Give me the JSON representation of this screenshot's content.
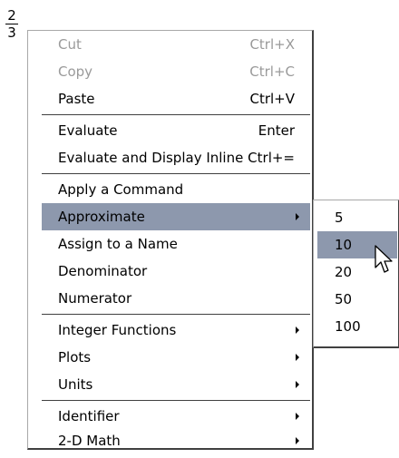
{
  "fraction": {
    "numerator": "2",
    "denominator": "3"
  },
  "context_menu": {
    "items": [
      {
        "label": "Cut",
        "shortcut": "Ctrl+X",
        "enabled": false
      },
      {
        "label": "Copy",
        "shortcut": "Ctrl+C",
        "enabled": false
      },
      {
        "label": "Paste",
        "shortcut": "Ctrl+V",
        "enabled": true
      },
      {
        "label": "Evaluate",
        "shortcut": "Enter",
        "enabled": true
      },
      {
        "label": "Evaluate and Display Inline",
        "shortcut": "Ctrl+=",
        "enabled": true
      },
      {
        "label": "Apply a Command",
        "enabled": true
      },
      {
        "label": "Approximate",
        "has_submenu": true,
        "highlighted": true
      },
      {
        "label": "Assign to a Name",
        "enabled": true
      },
      {
        "label": "Denominator",
        "enabled": true
      },
      {
        "label": "Numerator",
        "enabled": true
      },
      {
        "label": "Integer Functions",
        "has_submenu": true
      },
      {
        "label": "Plots",
        "has_submenu": true
      },
      {
        "label": "Units",
        "has_submenu": true
      },
      {
        "label": "Identifier",
        "has_submenu": true
      },
      {
        "label": "2-D Math",
        "has_submenu": true
      }
    ]
  },
  "approximate_submenu": {
    "items": [
      {
        "label": "5"
      },
      {
        "label": "10",
        "highlighted": true
      },
      {
        "label": "20"
      },
      {
        "label": "50"
      },
      {
        "label": "100"
      }
    ]
  },
  "colors": {
    "highlight": "#8d98ad",
    "disabled_text": "#9a9a9a"
  }
}
